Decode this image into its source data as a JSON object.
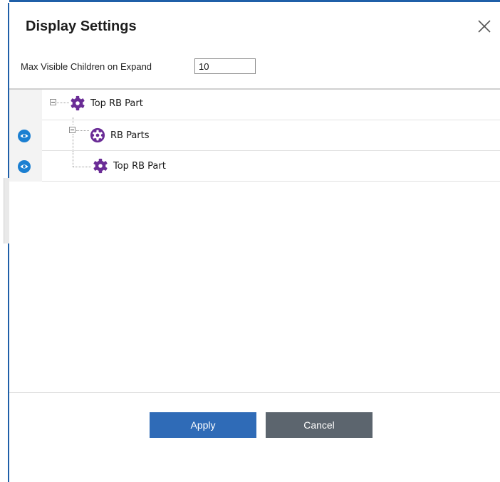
{
  "dialog": {
    "title": "Display Settings",
    "close_icon": "close-icon"
  },
  "settings": {
    "max_children_label": "Max Visible Children on Expand",
    "max_children_value": "10"
  },
  "tree": {
    "nodes": [
      {
        "label": "Top RB Part",
        "icon": "gear-icon",
        "visible_toggle": false,
        "expanded": true
      },
      {
        "label": "RB Parts",
        "icon": "gear-circle-icon",
        "visible_toggle": true,
        "expanded": true
      },
      {
        "label": "Top RB Part",
        "icon": "gear-icon",
        "visible_toggle": true,
        "expanded": false
      }
    ]
  },
  "footer": {
    "apply_label": "Apply",
    "cancel_label": "Cancel"
  },
  "colors": {
    "accent": "#2f6bb7",
    "eye": "#1b7fd1",
    "gear": "#6a2c96",
    "cancel": "#5c656e"
  }
}
